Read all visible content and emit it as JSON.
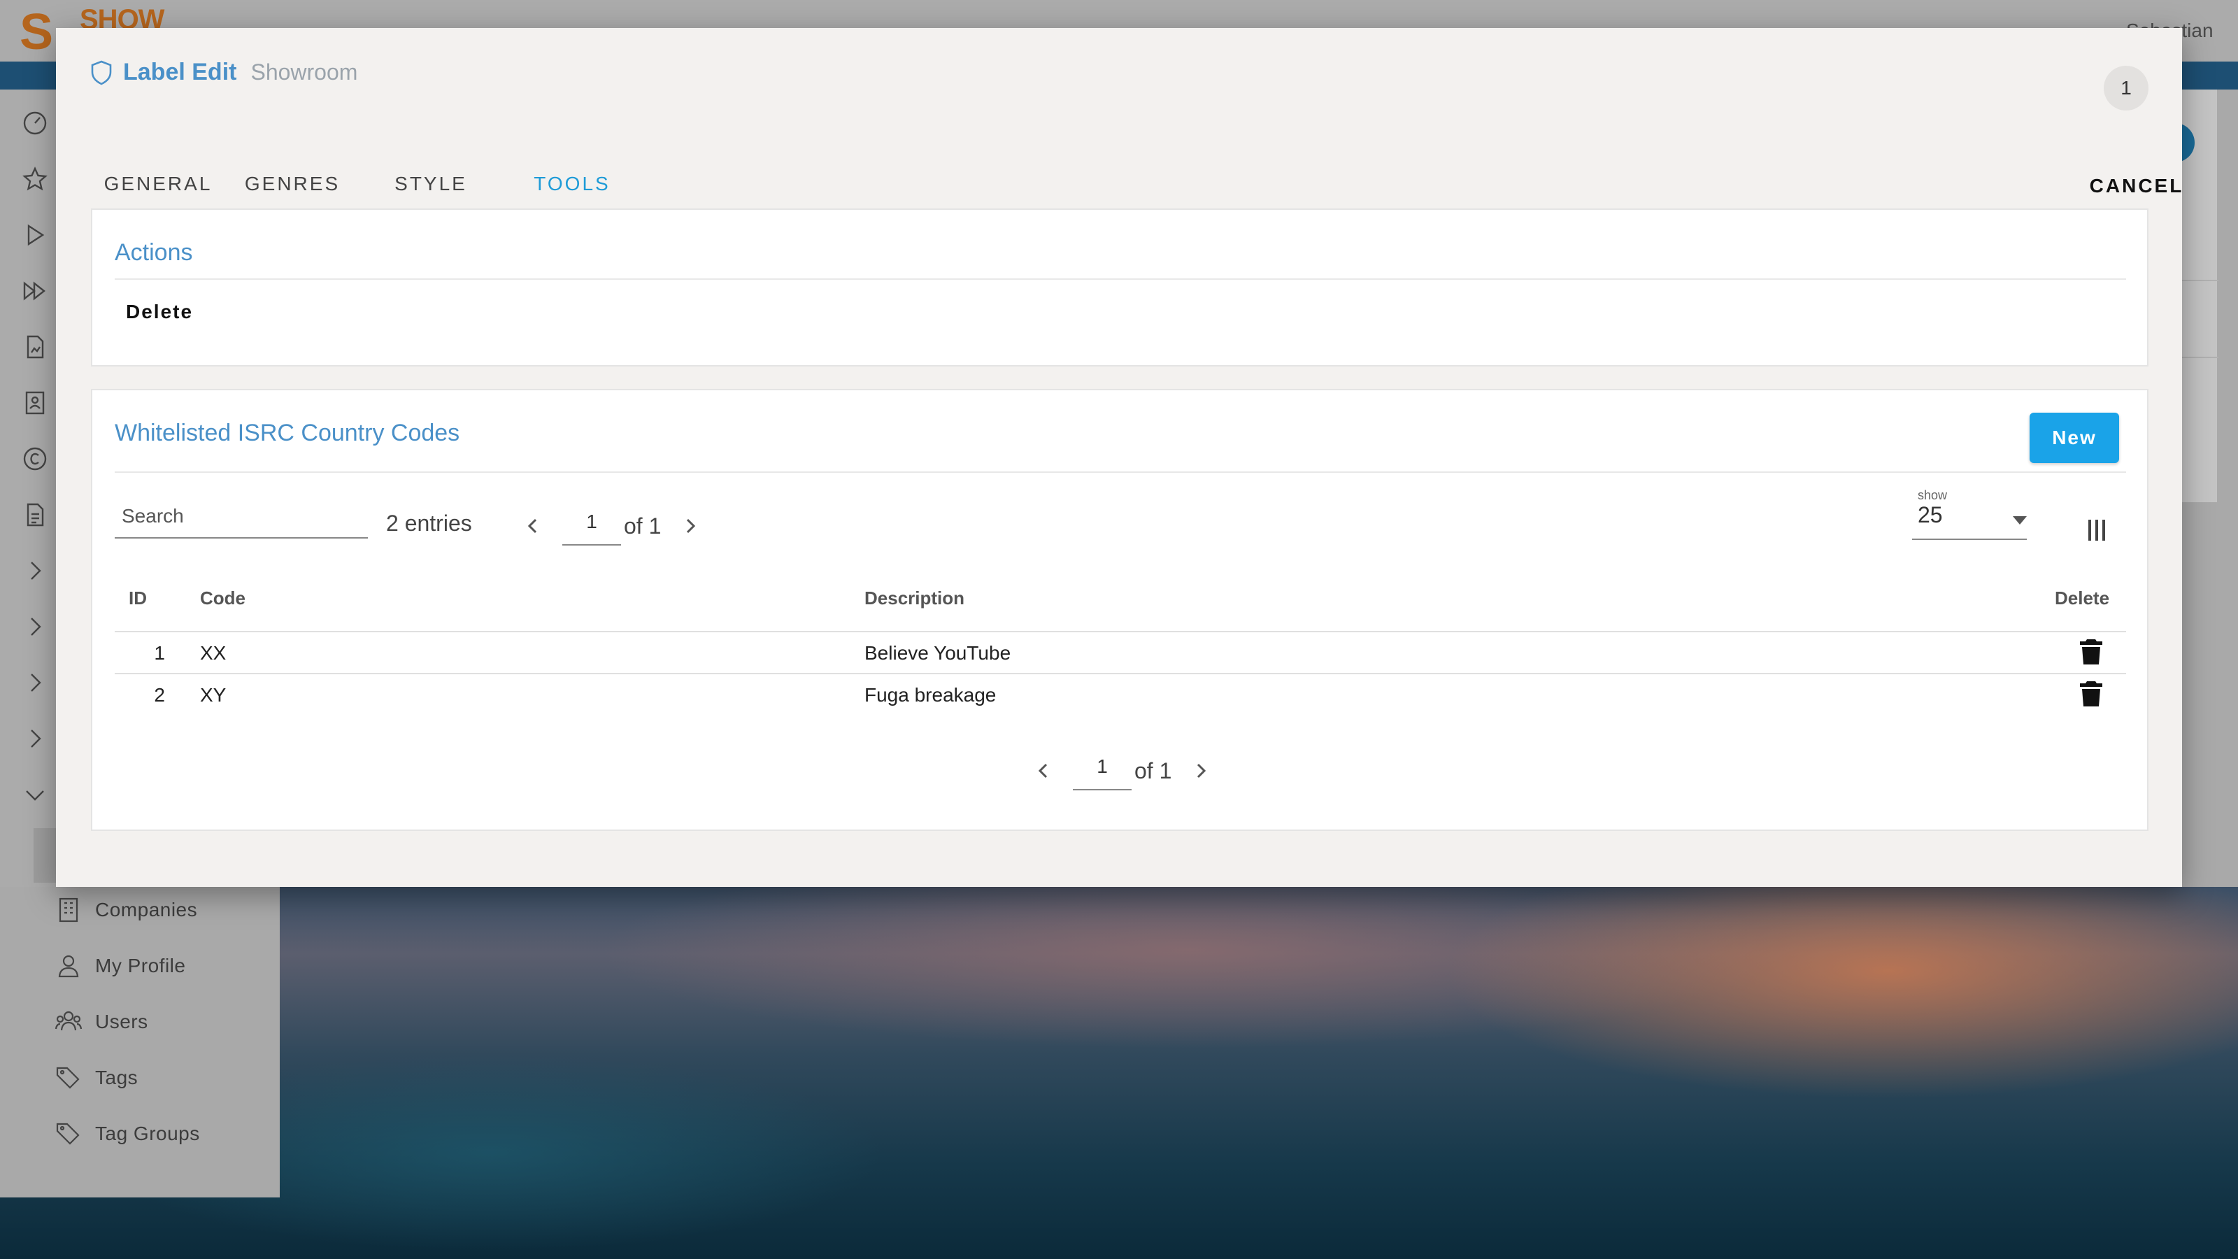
{
  "app": {
    "logo_text": "SHOW",
    "logo_letter": "S",
    "user_name": "Sebastian"
  },
  "sidebar": {
    "items": [
      {
        "label": "Companies",
        "icon": "building-icon"
      },
      {
        "label": "My Profile",
        "icon": "person-icon"
      },
      {
        "label": "Users",
        "icon": "users-icon"
      },
      {
        "label": "Tags",
        "icon": "tag-icon"
      },
      {
        "label": "Tag Groups",
        "icon": "tags-icon"
      }
    ]
  },
  "modal": {
    "title": "Label Edit",
    "subtitle": "Showroom",
    "badge": "1",
    "tabs": [
      {
        "label": "GENERAL",
        "active": false
      },
      {
        "label": "GENRES",
        "active": false
      },
      {
        "label": "STYLE",
        "active": false
      },
      {
        "label": "TOOLS",
        "active": true
      }
    ],
    "cancel_label": "CANCEL",
    "accent_color": "#1e9bd7",
    "heading_color": "#4a90c8"
  },
  "actions": {
    "title": "Actions",
    "delete_label": "Delete"
  },
  "whitelist": {
    "title": "Whitelisted ISRC Country Codes",
    "new_label": "New",
    "search_placeholder": "Search",
    "entries_text": "2 entries",
    "page": "1",
    "of_text": "of 1",
    "show_label": "show",
    "show_value": "25",
    "columns": {
      "id": "ID",
      "code": "Code",
      "description": "Description",
      "delete": "Delete"
    },
    "rows": [
      {
        "id": "1",
        "code": "XX",
        "description": "Believe YouTube"
      },
      {
        "id": "2",
        "code": "XY",
        "description": "Fuga breakage"
      }
    ],
    "bottom_page": "1",
    "bottom_of_text": "of 1"
  }
}
